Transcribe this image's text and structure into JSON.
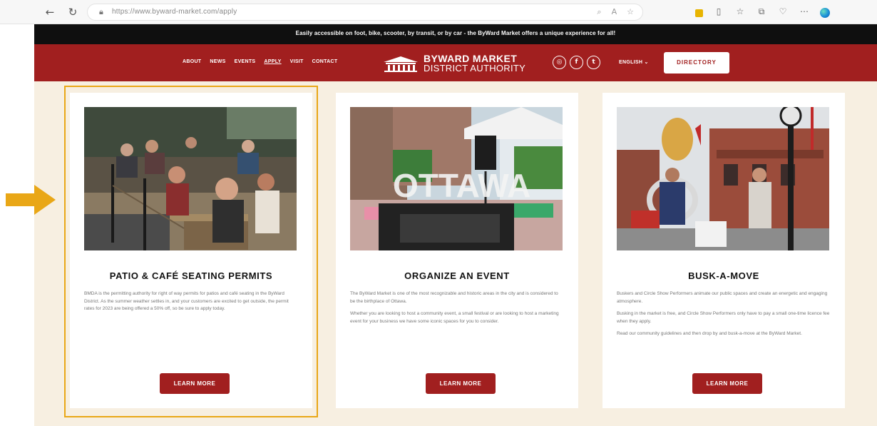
{
  "browser": {
    "url": "https://www.byward-market.com/apply",
    "icons": [
      "back-icon",
      "refresh-icon",
      "lock-icon",
      "zoom-icon",
      "read-aloud-icon",
      "favorite-icon",
      "collections-icon",
      "split-screen-icon",
      "favorites-bar-icon",
      "extensions-icon",
      "more-icon",
      "edge-icon"
    ]
  },
  "site": {
    "announcement": "Easily accessible on foot, bike, scooter, by transit, or by car - the ByWard Market offers a unique experience for all!",
    "nav": [
      "ABOUT",
      "NEWS",
      "EVENTS",
      "APPLY",
      "VISIT",
      "CONTACT"
    ],
    "active_nav": "APPLY",
    "logo_line1": "BYWARD MARKET",
    "logo_line2": "DISTRICT AUTHORITY",
    "socials": [
      "instagram-icon",
      "facebook-icon",
      "twitter-icon"
    ],
    "language": "ENGLISH ⌄",
    "directory_button": "DIRECTORY",
    "brand_color": "#a11f1f",
    "background_color": "#f7efe1",
    "highlight_color": "#e9a717"
  },
  "cards": [
    {
      "title": "PATIO & CAFÉ SEATING PERMITS",
      "paragraphs": [
        "BMDA is the permitting authority for right of way permits for patios and café seating in the ByWard District. As the summer weather settles in, and your customers are excited to get outside, the permit rates for 2023 are being offered a 50% off, so be sure to apply today."
      ],
      "button": "LEARN MORE"
    },
    {
      "title": "ORGANIZE AN EVENT",
      "paragraphs": [
        "The ByWard Market is one of the most recognizable and historic areas in the city and is considered to be the birthplace of Ottawa.",
        "Whether you are looking to host a community event, a small festival or are looking to host a marketing event for your business we have some iconic spaces for you to consider."
      ],
      "button": "LEARN MORE"
    },
    {
      "title": "BUSK-A-MOVE",
      "paragraphs": [
        "Buskers and Circle Show Performers animate our public spaces and create an energetic and engaging atmosphere.",
        "Busking in the market is free, and Circle Show Performers only have to pay a small one-time licence fee when they apply.",
        "Read our community guidelines and then drop by and busk-a-move at the ByWard Market."
      ],
      "button": "LEARN MORE"
    }
  ],
  "ottawa_sign": "OTTAWA"
}
